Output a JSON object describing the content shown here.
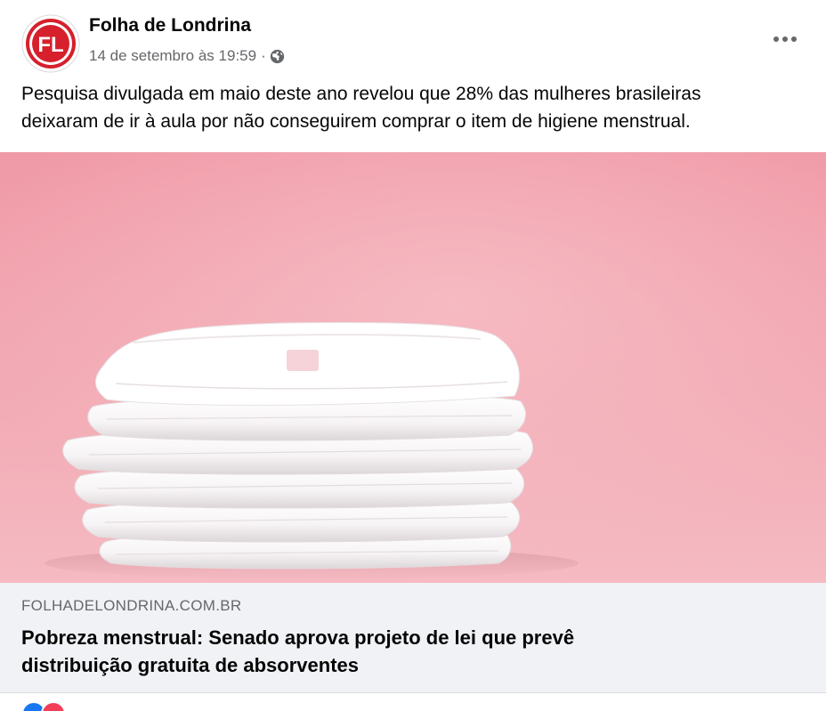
{
  "post": {
    "page_name": "Folha de Londrina",
    "avatar": {
      "initials": "FL",
      "icon": "folha-de-londrina-logo"
    },
    "timestamp": "14 de setembro às 19:59",
    "separator": "·",
    "privacy_icon": "globe-icon",
    "more_icon": "more-options-icon",
    "caption_lines": [
      "Pesquisa divulgada em maio deste ano revelou que 28% das mulheres brasileiras",
      "deixaram de ir à aula por não conseguirem comprar o item de higiene menstrual."
    ]
  },
  "link": {
    "image_subject": "stack-of-sanitary-pads-photo",
    "domain": "FOLHADELONDRINA.COM.BR",
    "title_lines": [
      "Pobreza menstrual: Senado aprova projeto de lei que prevê",
      "distribuição gratuita de absorventes"
    ]
  },
  "colors": {
    "brand_red": "#d6202c",
    "background_pink": "#f2a7b1",
    "text_primary": "#050505",
    "text_secondary": "#65676b",
    "link_info_bg": "#f0f2f5"
  }
}
